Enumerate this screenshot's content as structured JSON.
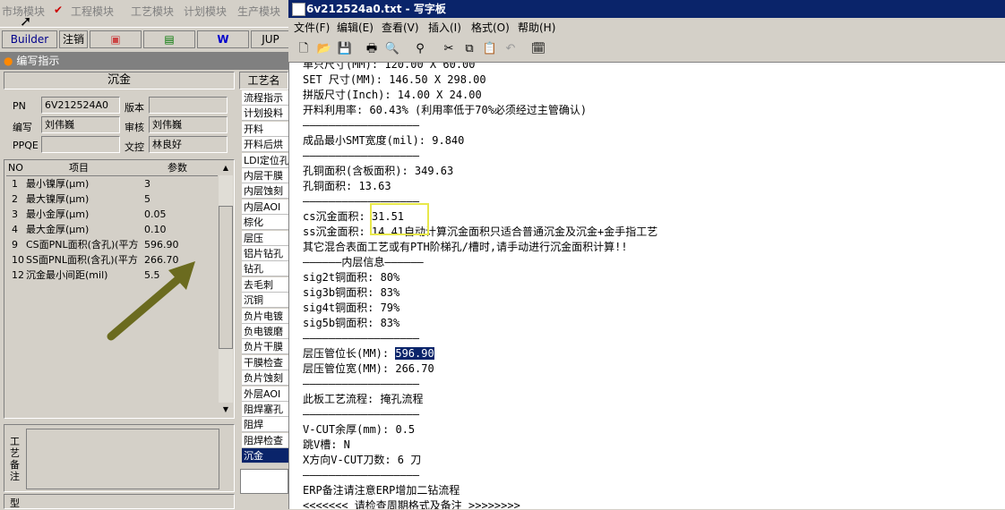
{
  "bg_app": {
    "menu": [
      "市场模块",
      "工程模块",
      "工艺模块",
      "计划模块",
      "生产模块"
    ],
    "toolbar": {
      "builder": "Builder",
      "logout": "注销",
      "jup": "JUP"
    },
    "panel_title": "编写指示",
    "section_title": "沉金",
    "fields": {
      "pn_label": "PN",
      "pn_value": "6V212524A0",
      "version_label": "版本",
      "version_value": "",
      "writer_label": "编写",
      "writer_value": "刘伟巍",
      "review_label": "审核",
      "review_value": "刘伟巍",
      "ppqe_label": "PPQE",
      "ppqe_value": "",
      "control_label": "文控",
      "control_value": "林良好"
    },
    "grid": {
      "headers": [
        "NO",
        "项目",
        "参数"
      ],
      "rows": [
        {
          "no": "1",
          "item": "最小镍厚(μm)",
          "value": "3"
        },
        {
          "no": "2",
          "item": "最大镍厚(μm)",
          "value": "5"
        },
        {
          "no": "3",
          "item": "最小金厚(μm)",
          "value": "0.05"
        },
        {
          "no": "4",
          "item": "最大金厚(μm)",
          "value": "0.10"
        },
        {
          "no": "9",
          "item": "CS面PNL面积(含孔)(平方",
          "value": "596.90"
        },
        {
          "no": "10",
          "item": "SS面PNL面积(含孔)(平方",
          "value": "266.70"
        },
        {
          "no": "12",
          "item": "沉金最小间距(mil)",
          "value": "5.5"
        }
      ]
    },
    "notes_label": "工艺备注",
    "type_label": "型",
    "process_header": "工艺名",
    "process_list": [
      "流程指示",
      "计划投料",
      "开料",
      "开料后烘",
      "LDI定位孔",
      "内层干膜",
      "内层蚀刻",
      "内层AOI",
      "棕化",
      "层压",
      "铝片钻孔",
      "钻孔",
      "去毛刺",
      "沉铜",
      "负片电镀",
      "负电镀磨",
      "负片干膜",
      "干膜检查",
      "负片蚀刻",
      "外层AOI",
      "阻焊塞孔",
      "阻焊",
      "阻焊检查",
      "沉金"
    ]
  },
  "wordpad": {
    "title": "6v212524a0.txt - 写字板",
    "menu": [
      "文件(F)",
      "编辑(E)",
      "查看(V)",
      "插入(I)",
      "格式(O)",
      "帮助(H)"
    ],
    "lines": [
      "单只尺寸(MM): 120.00 X 60.00",
      "SET 尺寸(MM): 146.50 X 298.00",
      "拼版尺寸(Inch): 14.00 X 24.00",
      "开料利用率: 60.43% (利用率低于70%必须经过主管确认)",
      "——————————————————",
      "成品最小SMT宽度(mil): 9.840",
      "——————————————————",
      "孔铜面积(含板面积): 349.63",
      "孔铜面积: 13.63",
      "——————————————————",
      "cs沉金面积: 31.51",
      "ss沉金面积: 14.41自动计算沉金面积只适合普通沉金及沉金+金手指工艺",
      "其它混合表面工艺或有PTH阶梯孔/槽时,请手动进行沉金面积计算!!",
      "——————内层信息——————",
      "sig2t铜面积: 80%",
      "sig3b铜面积: 83%",
      "sig4t铜面积: 79%",
      "sig5b铜面积: 83%",
      "——————————————————",
      "层压管位长(MM): 596.90",
      "层压管位宽(MM): 266.70",
      "——————————————————",
      "此板工艺流程: 掩孔流程",
      "——————————————————",
      "V-CUT余厚(mm): 0.5",
      "跳V槽: N",
      "X方向V-CUT刀数: 6 刀",
      "——————————————————",
      "ERP备注请注意ERP增加二钻流程",
      "<<<<<<< 请检查周期格式及备注 >>>>>>>>"
    ],
    "selected_value": "596.90",
    "highlight_value": "31.51",
    "colors": {
      "selection": "#0a246a",
      "highlight_box": "#e8e84a",
      "arrow": "#6b6b1f"
    }
  }
}
